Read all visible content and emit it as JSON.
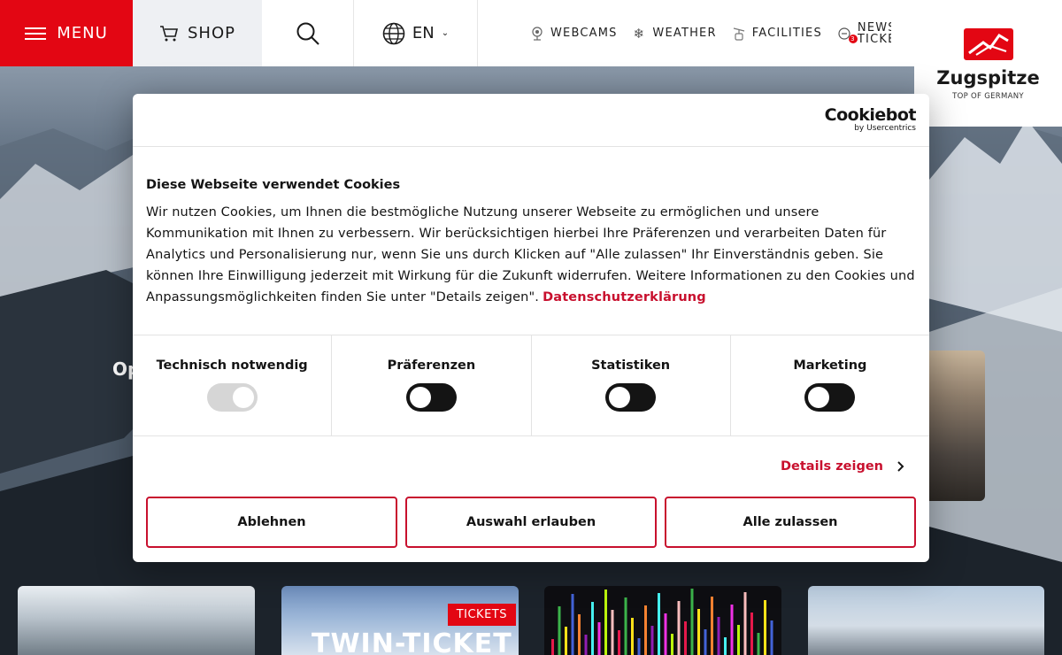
{
  "header": {
    "menu_label": "MENU",
    "shop_label": "SHOP",
    "language_label": "EN",
    "nav": [
      {
        "label": "WEBCAMS",
        "icon": "webcam-icon"
      },
      {
        "label": "WEATHER",
        "icon": "snowflake-icon"
      },
      {
        "label": "FACILITIES",
        "icon": "cable-car-icon"
      }
    ],
    "newsticker_line1": "NEWS",
    "newsticker_line2": "TICKE",
    "newsticker_count": "3"
  },
  "logo": {
    "name": "Zugspitze",
    "tagline": "TOP OF GERMANY"
  },
  "background": {
    "partial_heading": "Op"
  },
  "cards": [
    {
      "badge": "",
      "title": ""
    },
    {
      "badge": "TICKETS",
      "title": "TWIN-TICKET"
    },
    {
      "badge": "",
      "title": ""
    },
    {
      "badge": "",
      "title": ""
    }
  ],
  "cookie_dialog": {
    "provider_name": "Cookiebot",
    "provider_sub": "by Usercentrics",
    "title": "Diese Webseite verwendet Cookies",
    "text": "Wir nutzen Cookies, um Ihnen die bestmögliche Nutzung unserer Webseite zu ermöglichen und unsere Kommunikation mit Ihnen zu verbessern. Wir berücksichtigen hierbei Ihre Präferenzen und verarbeiten Daten für Analytics und Personalisierung nur, wenn Sie uns durch Klicken auf \"Alle zulassen\" Ihr Einverständnis geben. Sie können Ihre Einwilligung jederzeit mit Wirkung für die Zukunft widerrufen. Weitere Informationen zu den Cookies und Anpassungsmöglichkeiten finden Sie unter \"Details zeigen\".",
    "privacy_link": "Datenschutzerklärung",
    "categories": [
      {
        "label": "Technisch notwendig",
        "state": "on-disabled"
      },
      {
        "label": "Präferenzen",
        "state": "off"
      },
      {
        "label": "Statistiken",
        "state": "off"
      },
      {
        "label": "Marketing",
        "state": "off"
      }
    ],
    "details_label": "Details zeigen",
    "buttons": {
      "decline": "Ablehnen",
      "allow_selection": "Auswahl erlauben",
      "allow_all": "Alle zulassen"
    }
  },
  "colors": {
    "brand_red": "#e30613",
    "link_red": "#c8102e"
  }
}
